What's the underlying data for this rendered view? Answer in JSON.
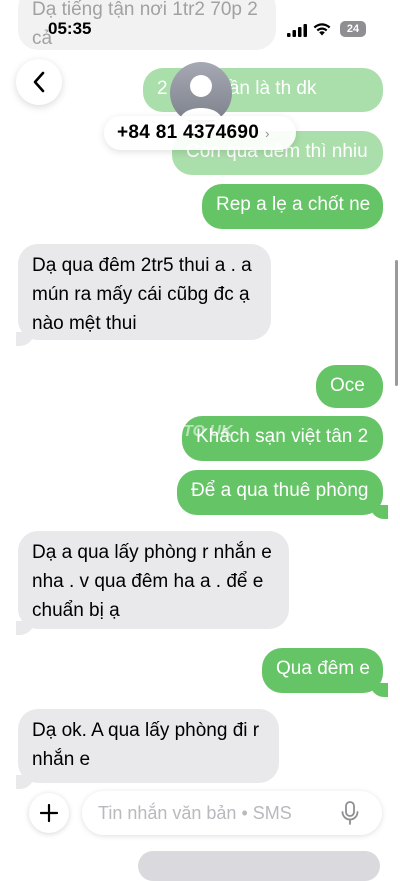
{
  "status_bar": {
    "time": "05:35",
    "battery": "24"
  },
  "header": {
    "contact_number": "+84 81 4374690"
  },
  "messages": [
    {
      "dir": "in",
      "text": "Dạ tiếng tận nơi 1tr2 70p 2 cả"
    },
    {
      "dir": "out",
      "text": "2 ... hai lần là th dk"
    },
    {
      "dir": "out",
      "text": "Còn qua đêm thì nhiu"
    },
    {
      "dir": "out",
      "text": "Rep a lẹ a chốt ne"
    },
    {
      "dir": "in",
      "text": "Dạ qua đêm 2tr5 thui a . a mún ra mấy cái cũbg đc ạ nào mệt thui"
    },
    {
      "dir": "out",
      "text": "Oce"
    },
    {
      "dir": "out",
      "text": "Khách sạn việt tân 2"
    },
    {
      "dir": "out",
      "text": "Để a qua thuê phòng"
    },
    {
      "dir": "in",
      "text": "Dạ a qua lấy phòng r nhắn e nha . v qua đêm ha a . để e chuẩn bị ạ"
    },
    {
      "dir": "out",
      "text": "Qua đêm e"
    },
    {
      "dir": "in",
      "text": "Dạ ok. A qua lấy phòng đi r nhắn e"
    }
  ],
  "watermark": "TO UK",
  "composer": {
    "placeholder": "Tin nhắn văn bản • SMS"
  },
  "icons": {
    "back": "chevron-left-icon",
    "plus": "plus-icon",
    "mic": "microphone-icon",
    "signal": "cellular-signal-icon",
    "wifi": "wifi-icon",
    "battery": "battery-icon",
    "avatar": "person-icon"
  },
  "colors": {
    "outgoing": "#65c466",
    "incoming": "#e9e9eb"
  }
}
